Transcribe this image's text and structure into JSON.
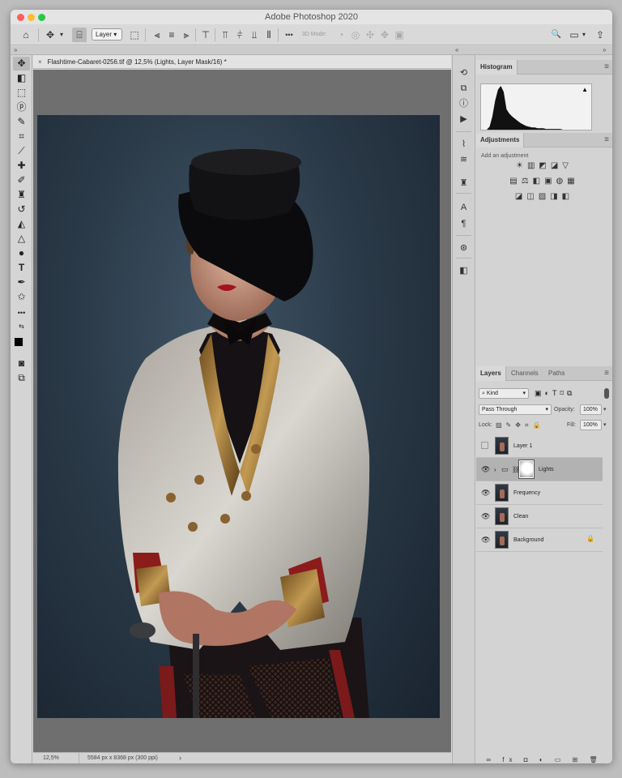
{
  "window": {
    "title": "Adobe Photoshop 2020"
  },
  "options_bar": {
    "home_icon": "⌂",
    "move_icon": "✥",
    "auto_select_icon": "⌸",
    "layer_select": "Layer",
    "mode_3d_label": "3D Mode:",
    "more_icon": "•••",
    "search_icon": "🔍",
    "workspace_icon": "▭",
    "share_icon": "⇪"
  },
  "document": {
    "tab_close": "×",
    "tab_title": "Flashtime-Cabaret-0256.tif @ 12,5% (Lights, Layer Mask/16) *"
  },
  "status_bar": {
    "zoom": "12,5%",
    "doc_info": "5584 px x 8368 px (300 ppi)",
    "arrow": "›"
  },
  "histogram": {
    "tab": "Histogram",
    "warning_icon": "▲",
    "shape": [
      0,
      0,
      0,
      4,
      18,
      40,
      55,
      60,
      52,
      28,
      22,
      18,
      15,
      12,
      9,
      7,
      5,
      4,
      3,
      3,
      2,
      2,
      2,
      1,
      1,
      1,
      1,
      1,
      1,
      0,
      0,
      0,
      0,
      0,
      0,
      0,
      0,
      0,
      0,
      0
    ]
  },
  "adjustments": {
    "tab": "Adjustments",
    "label": "Add an adjustment",
    "row1": "☀▥◩◪▽",
    "row2": "▤⚖◧▣◍▦",
    "row3": "◪◫▧◨◧"
  },
  "layers_panel": {
    "tabs": [
      "Layers",
      "Channels",
      "Paths"
    ],
    "kind_filter": "Kind",
    "blend_mode": "Pass Through",
    "opacity_label": "Opacity:",
    "opacity_value": "100%",
    "lock_label": "Lock:",
    "fill_label": "Fill:",
    "fill_value": "100%",
    "layers": [
      {
        "name": "Layer 1",
        "visible": false
      },
      {
        "name": "Lights",
        "visible": true
      },
      {
        "name": "Frequency",
        "visible": true
      },
      {
        "name": "Clean",
        "visible": true
      },
      {
        "name": "Background",
        "visible": true,
        "locked": true
      }
    ],
    "bottom_icons": "∞ fx ◘ ◐ ▭ ⊞ 🗑"
  },
  "icons": {
    "eye": "👁",
    "lock": "🔒",
    "panel_menu": "≡",
    "expand": "›"
  },
  "colors": {
    "canvas_bg": "#6f6f6f",
    "selected_layer": "#b2b2b2"
  }
}
